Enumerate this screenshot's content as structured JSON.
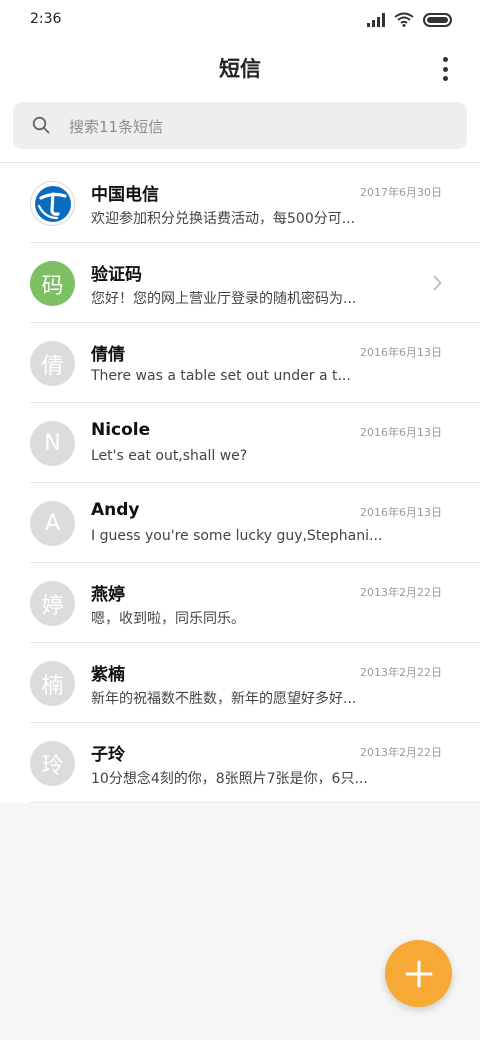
{
  "status_bar": {
    "time": "2:36"
  },
  "app_bar": {
    "title": "短信",
    "menu_icon": "more-vertical-icon"
  },
  "search": {
    "placeholder": "搜索11条短信"
  },
  "colors": {
    "fab": "#f7a935",
    "verify_avatar": "#7dbf63",
    "telecom_blue": "#0b6bbd"
  },
  "conversations": [
    {
      "name": "中国电信",
      "preview": "欢迎参加积分兑换话费活动，每500分可...",
      "date": "2017年6月30日",
      "avatar": "telecom-logo-icon"
    },
    {
      "name": "验证码",
      "preview": "您好！您的网上营业厅登录的随机密码为...",
      "date": "",
      "avatar_text": "码"
    },
    {
      "name": "倩倩",
      "preview": "There was a table set out under a t...",
      "date": "2016年6月13日",
      "avatar_text": "倩"
    },
    {
      "name": "Nicole",
      "preview": "Let's eat out,shall we?",
      "date": "2016年6月13日",
      "avatar_text": "N"
    },
    {
      "name": "Andy",
      "preview": "I guess you're some lucky guy,Stephani...",
      "date": "2016年6月13日",
      "avatar_text": "A"
    },
    {
      "name": "燕婷",
      "preview": "嗯，收到啦，同乐同乐。",
      "date": "2013年2月22日",
      "avatar_text": "婷"
    },
    {
      "name": "紫楠",
      "preview": "新年的祝福数不胜数，新年的愿望好多好...",
      "date": "2013年2月22日",
      "avatar_text": "楠"
    },
    {
      "name": "子玲",
      "preview": "10分想念4刻的你，8张照片7张是你，6只...",
      "date": "2013年2月22日",
      "avatar_text": "玲"
    }
  ],
  "fab": {
    "icon": "plus-icon"
  }
}
